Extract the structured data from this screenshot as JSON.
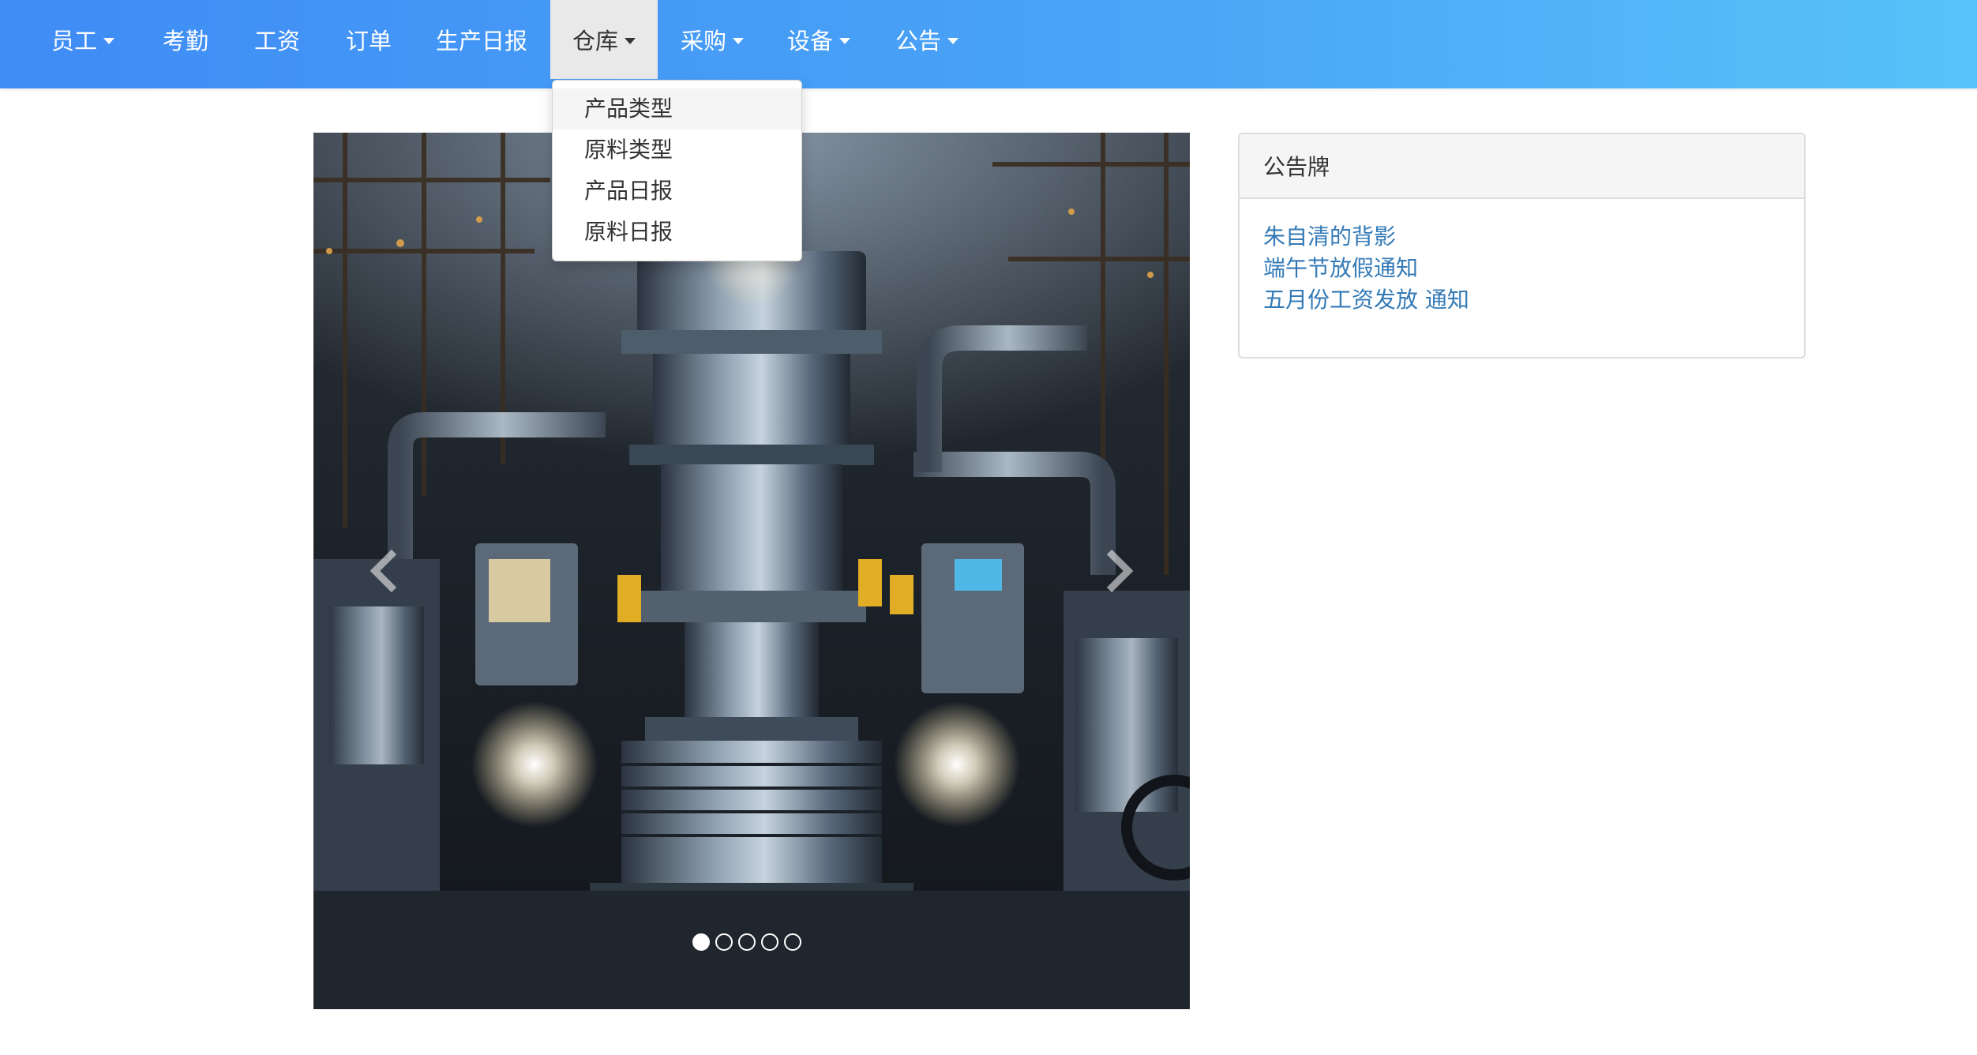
{
  "nav": {
    "items": [
      {
        "label": "员工",
        "has_caret": true
      },
      {
        "label": "考勤",
        "has_caret": false
      },
      {
        "label": "工资",
        "has_caret": false
      },
      {
        "label": "订单",
        "has_caret": false
      },
      {
        "label": "生产日报",
        "has_caret": false
      },
      {
        "label": "仓库",
        "has_caret": true,
        "active": true
      },
      {
        "label": "采购",
        "has_caret": true
      },
      {
        "label": "设备",
        "has_caret": true
      },
      {
        "label": "公告",
        "has_caret": true
      }
    ]
  },
  "warehouse_dropdown": {
    "items": [
      "产品类型",
      "原料类型",
      "产品日报",
      "原料日报"
    ]
  },
  "carousel": {
    "image": "industrial-machinery-photo",
    "slide_count": 5,
    "active_slide": 1,
    "prev_icon": "chevron-left-icon",
    "next_icon": "chevron-right-icon"
  },
  "notice_board": {
    "title": "公告牌",
    "links": [
      "朱自清的背影",
      "端午节放假通知",
      "五月份工资发放 通知"
    ]
  },
  "colors": {
    "nav_gradient_start": "#3f8cf5",
    "nav_gradient_end": "#58c2f9",
    "link": "#337ab7",
    "active_nav_bg": "#e9e9e9"
  }
}
